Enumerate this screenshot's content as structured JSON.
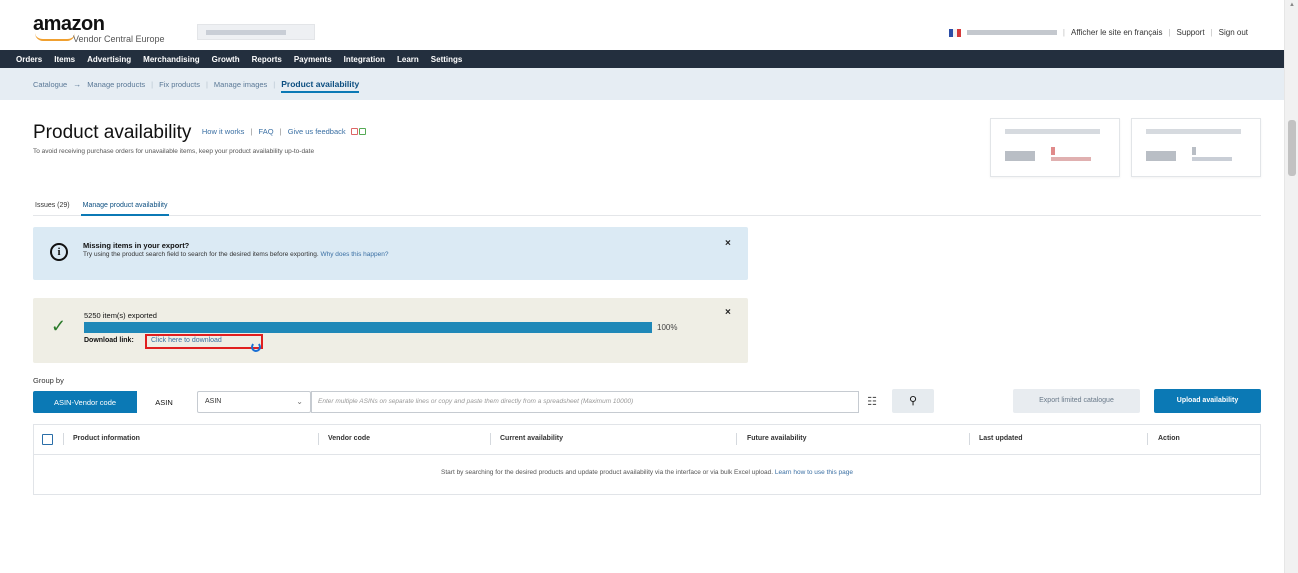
{
  "header": {
    "logo_text": "amazon",
    "logo_sub": "Vendor Central Europe",
    "links": [
      "Afficher le site en français",
      "Support",
      "Sign out"
    ]
  },
  "nav": {
    "items": [
      "Orders",
      "Items",
      "Advertising",
      "Merchandising",
      "Growth",
      "Reports",
      "Payments",
      "Integration",
      "Learn",
      "Settings"
    ]
  },
  "subnav": {
    "catalogue": "Catalogue",
    "arrow": "→",
    "items": [
      "Manage products",
      "Fix products",
      "Manage images"
    ],
    "active": "Product availability"
  },
  "page": {
    "title": "Product availability",
    "link_how": "How it works",
    "link_faq": "FAQ",
    "link_feedback": "Give us feedback",
    "subtitle": "To avoid receiving purchase orders for unavailable items, keep your product availability up-to-date"
  },
  "tabs": [
    "Issues (29)",
    "Manage product availability"
  ],
  "info_banner": {
    "title": "Missing items in your export?",
    "text": "Try using the product search field to search for the desired items before exporting.",
    "link": "Why does this happen?",
    "close": "×"
  },
  "export_banner": {
    "title": "5250 item(s) exported",
    "progress": 1.0,
    "percent_label": "100%",
    "download_label": "Download link:",
    "download_link": "Click here to download",
    "close": "×"
  },
  "group_by": {
    "label": "Group by",
    "options": [
      "ASIN-Vendor code",
      "ASIN"
    ],
    "selected": "ASIN-Vendor code"
  },
  "search": {
    "select_value": "ASIN",
    "placeholder": "Enter multiple ASINs on separate lines or copy and paste them directly from a spreadsheet (Maximum 10000)"
  },
  "buttons": {
    "export": "Export limited catalogue",
    "upload": "Upload availability"
  },
  "table": {
    "columns": [
      "Product information",
      "Vendor code",
      "Current availability",
      "Future availability",
      "Last updated",
      "Action"
    ],
    "empty_text": "Start by searching for the desired products and update product availability via the interface or via bulk Excel upload.",
    "empty_link": "Learn how to use this page"
  },
  "colors": {
    "nav_bg": "#232f3e",
    "accent": "#0b79b5",
    "info_bg": "#dbeaf4",
    "success_bg": "#efeee5",
    "highlight": "#e01f1f"
  }
}
